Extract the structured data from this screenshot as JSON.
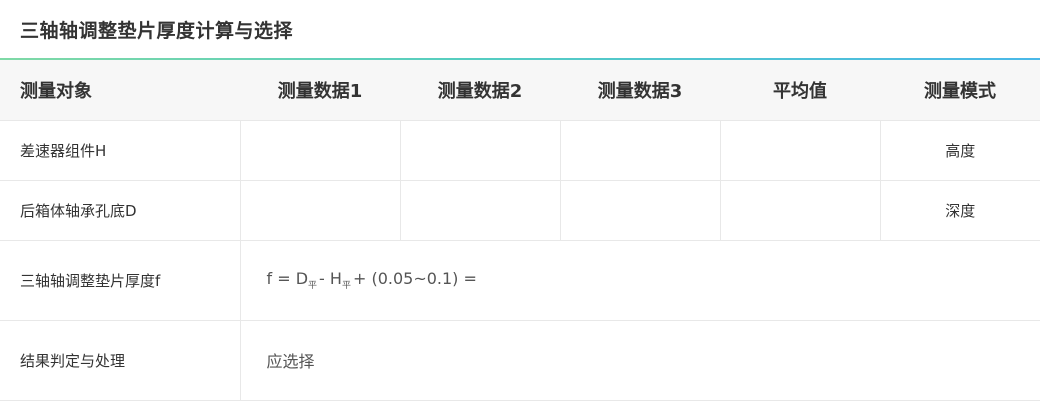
{
  "header": {
    "title": "三轴轴调整垫片厚度计算与选择"
  },
  "table": {
    "columns": [
      "测量对象",
      "测量数据1",
      "测量数据2",
      "测量数据3",
      "平均值",
      "测量模式"
    ],
    "rows": [
      {
        "object": "差速器组件H",
        "data1": "",
        "data2": "",
        "data3": "",
        "average": "",
        "mode": "高度"
      },
      {
        "object": "后箱体轴承孔底D",
        "data1": "",
        "data2": "",
        "data3": "",
        "average": "",
        "mode": "深度"
      }
    ],
    "formula_row": {
      "label": "三轴轴调整垫片厚度f",
      "formula": {
        "f_eq": "f = D",
        "sub1": "平",
        "minus_h": "- H",
        "sub2": "平",
        "tail": "+ (0.05~0.1) ="
      }
    },
    "result_row": {
      "label": "结果判定与处理",
      "value": "应选择"
    }
  }
}
